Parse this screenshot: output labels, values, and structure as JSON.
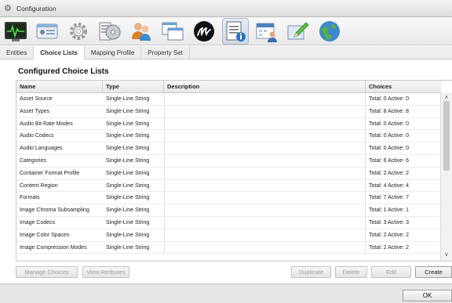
{
  "window": {
    "title": "Configuration"
  },
  "toolbar": {
    "icons": [
      "waveform-monitor-icon",
      "id-card-icon",
      "gear-settings-icon",
      "disc-library-icon",
      "users-icon",
      "windows-icon",
      "brand-logo-icon",
      "list-info-icon",
      "calendar-user-icon",
      "edit-pencil-icon",
      "globe-icon"
    ],
    "active_index": 7
  },
  "tabs": [
    {
      "label": "Entities",
      "active": false
    },
    {
      "label": "Choice Lists",
      "active": true
    },
    {
      "label": "Mapping Profile",
      "active": false
    },
    {
      "label": "Property Set",
      "active": false
    }
  ],
  "panel": {
    "title": "Configured Choice Lists"
  },
  "table": {
    "headers": {
      "name": "Name",
      "type": "Type",
      "description": "Description",
      "choices": "Choices"
    },
    "rows": [
      {
        "name": "Asset Source",
        "type": "Single-Line String",
        "description": "",
        "choices": "Total: 0 Active: 0"
      },
      {
        "name": "Asset Types",
        "type": "Single-Line String",
        "description": "",
        "choices": "Total: 8 Active: 8"
      },
      {
        "name": "Audio Bit Rate Modes",
        "type": "Single-Line String",
        "description": "",
        "choices": "Total: 0 Active: 0"
      },
      {
        "name": "Audio Codecs",
        "type": "Single-Line String",
        "description": "",
        "choices": "Total: 0 Active: 0"
      },
      {
        "name": "Audio Languages",
        "type": "Single-Line String",
        "description": "",
        "choices": "Total: 0 Active: 0"
      },
      {
        "name": "Categories",
        "type": "Single-Line String",
        "description": "",
        "choices": "Total: 6 Active: 6"
      },
      {
        "name": "Container Format Profile",
        "type": "Single-Line String",
        "description": "",
        "choices": "Total: 2 Active: 2"
      },
      {
        "name": "Content Region",
        "type": "Single-Line String",
        "description": "",
        "choices": "Total: 4 Active: 4"
      },
      {
        "name": "Formats",
        "type": "Single-Line String",
        "description": "",
        "choices": "Total: 7 Active: 7"
      },
      {
        "name": "Image Chroma Subsampling",
        "type": "Single-Line String",
        "description": "",
        "choices": "Total: 1 Active: 1"
      },
      {
        "name": "Image Codecs",
        "type": "Single-Line String",
        "description": "",
        "choices": "Total: 3 Active: 3"
      },
      {
        "name": "Image Color Spaces",
        "type": "Single-Line String",
        "description": "",
        "choices": "Total: 2 Active: 2"
      },
      {
        "name": "Image Compression Modes",
        "type": "Single-Line String",
        "description": "",
        "choices": "Total: 2 Active: 2"
      }
    ]
  },
  "buttons": {
    "manage_choices": "Manage Choices",
    "view_attributes": "View Attributes",
    "duplicate": "Duplicate",
    "delete": "Delete",
    "edit": "Edit",
    "create": "Create",
    "ok": "OK"
  }
}
